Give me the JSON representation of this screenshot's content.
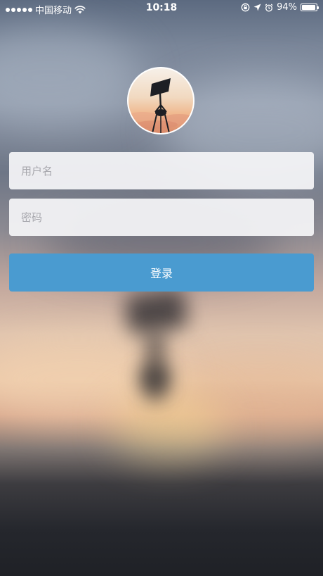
{
  "status_bar": {
    "carrier": "中国移动",
    "time": "10:18",
    "battery_percent": "94%",
    "battery_level": 0.94,
    "icons": [
      "signal-dots",
      "wifi-icon",
      "rotation-lock-icon",
      "location-arrow-icon",
      "alarm-icon",
      "battery-icon"
    ]
  },
  "avatar": {
    "icon": "street-lamp-photo"
  },
  "login_form": {
    "username_placeholder": "用户名",
    "password_placeholder": "密码",
    "submit_label": "登录"
  },
  "colors": {
    "button": "#4a9bd0",
    "field_background": "#f5f5f7",
    "placeholder": "#a7a7ad"
  }
}
